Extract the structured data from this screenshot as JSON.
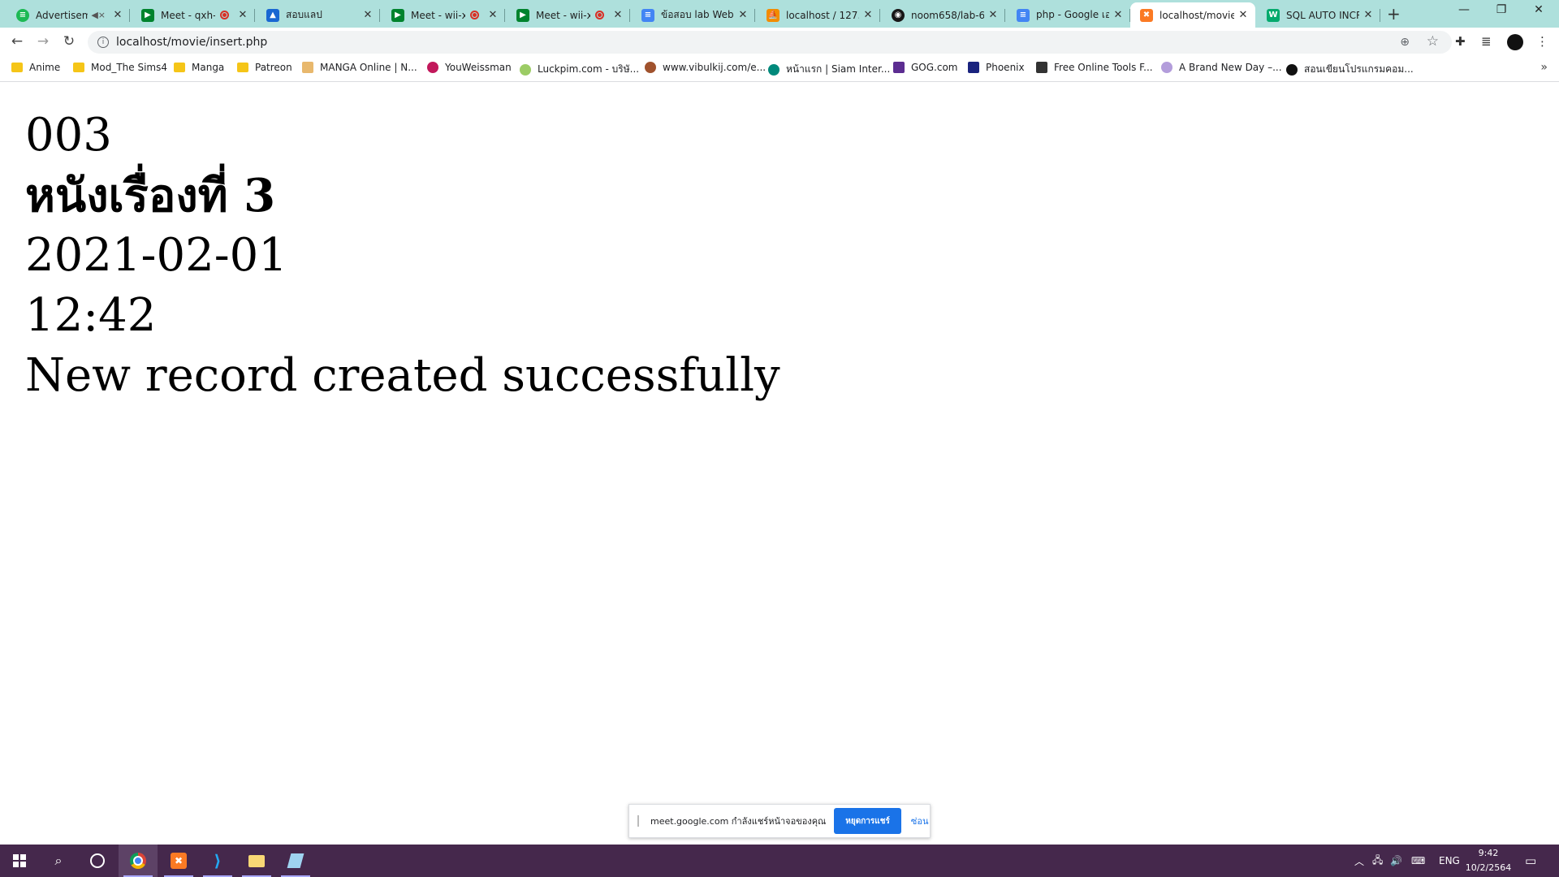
{
  "browser": {
    "tabs": [
      {
        "label": "Advertiseme",
        "favicon": "spotify-icon",
        "color": "#1db954",
        "muted": true
      },
      {
        "label": "Meet - qxh-",
        "favicon": "meet-icon",
        "color": "#00832d",
        "recording": true
      },
      {
        "label": "สอบแลป",
        "favicon": "classroom-icon",
        "color": "#1967d2"
      },
      {
        "label": "Meet - wii-x",
        "favicon": "meet-icon",
        "color": "#00832d",
        "recording": true
      },
      {
        "label": "Meet - wii-x",
        "favicon": "meet-icon",
        "color": "#00832d",
        "recording": true
      },
      {
        "label": "ข้อสอบ lab Web P",
        "favicon": "docs-icon",
        "color": "#4285f4"
      },
      {
        "label": "localhost / 127.0",
        "favicon": "phpmyadmin-icon",
        "color": "#f28c00"
      },
      {
        "label": "noom658/lab-6",
        "favicon": "github-icon",
        "color": "#181717"
      },
      {
        "label": "php - Google เอ",
        "favicon": "docs-icon",
        "color": "#4285f4"
      },
      {
        "label": "localhost/movie",
        "favicon": "xampp-icon",
        "color": "#fb7a24",
        "active": true
      },
      {
        "label": "SQL AUTO INCR",
        "favicon": "w3schools-icon",
        "color": "#04aa6d"
      }
    ],
    "url": "localhost/movie/insert.php",
    "bookmarks": [
      {
        "label": "Anime",
        "type": "folder"
      },
      {
        "label": "Mod_The Sims4",
        "type": "folder"
      },
      {
        "label": "Manga",
        "type": "folder"
      },
      {
        "label": "Patreon",
        "type": "folder"
      },
      {
        "label": "MANGA Online | N...",
        "type": "link",
        "color": "#e8b86d"
      },
      {
        "label": "YouWeissman",
        "type": "link",
        "color": "#c2185b"
      },
      {
        "label": "Luckpim.com - บริษั...",
        "type": "link",
        "color": "#9ccc65"
      },
      {
        "label": "www.vibulkij.com/e...",
        "type": "link",
        "color": "#a0522d"
      },
      {
        "label": "หน้าแรก | Siam Inter...",
        "type": "link",
        "color": "#00897b"
      },
      {
        "label": "GOG.com",
        "type": "link",
        "color": "#5c2d91"
      },
      {
        "label": "Phoenix",
        "type": "link",
        "color": "#1a237e"
      },
      {
        "label": "Free Online Tools F...",
        "type": "link",
        "color": "#333333"
      },
      {
        "label": "A Brand New Day –...",
        "type": "link",
        "color": "#b39ddb"
      },
      {
        "label": "สอนเขียนโปรแกรมคอม...",
        "type": "link",
        "color": "#111111"
      }
    ]
  },
  "page": {
    "lines": [
      "003",
      "หนังเรื่องที่ 3",
      "2021-02-01",
      "12:42",
      "New record created successfully"
    ]
  },
  "share_notice": {
    "message": "meet.google.com กำลังแชร์หน้าจอของคุณ",
    "stop_label": "หยุดการแชร์",
    "hide_label": "ซ่อน"
  },
  "taskbar": {
    "language": "ENG",
    "time": "9:42",
    "date": "10/2/2564"
  }
}
